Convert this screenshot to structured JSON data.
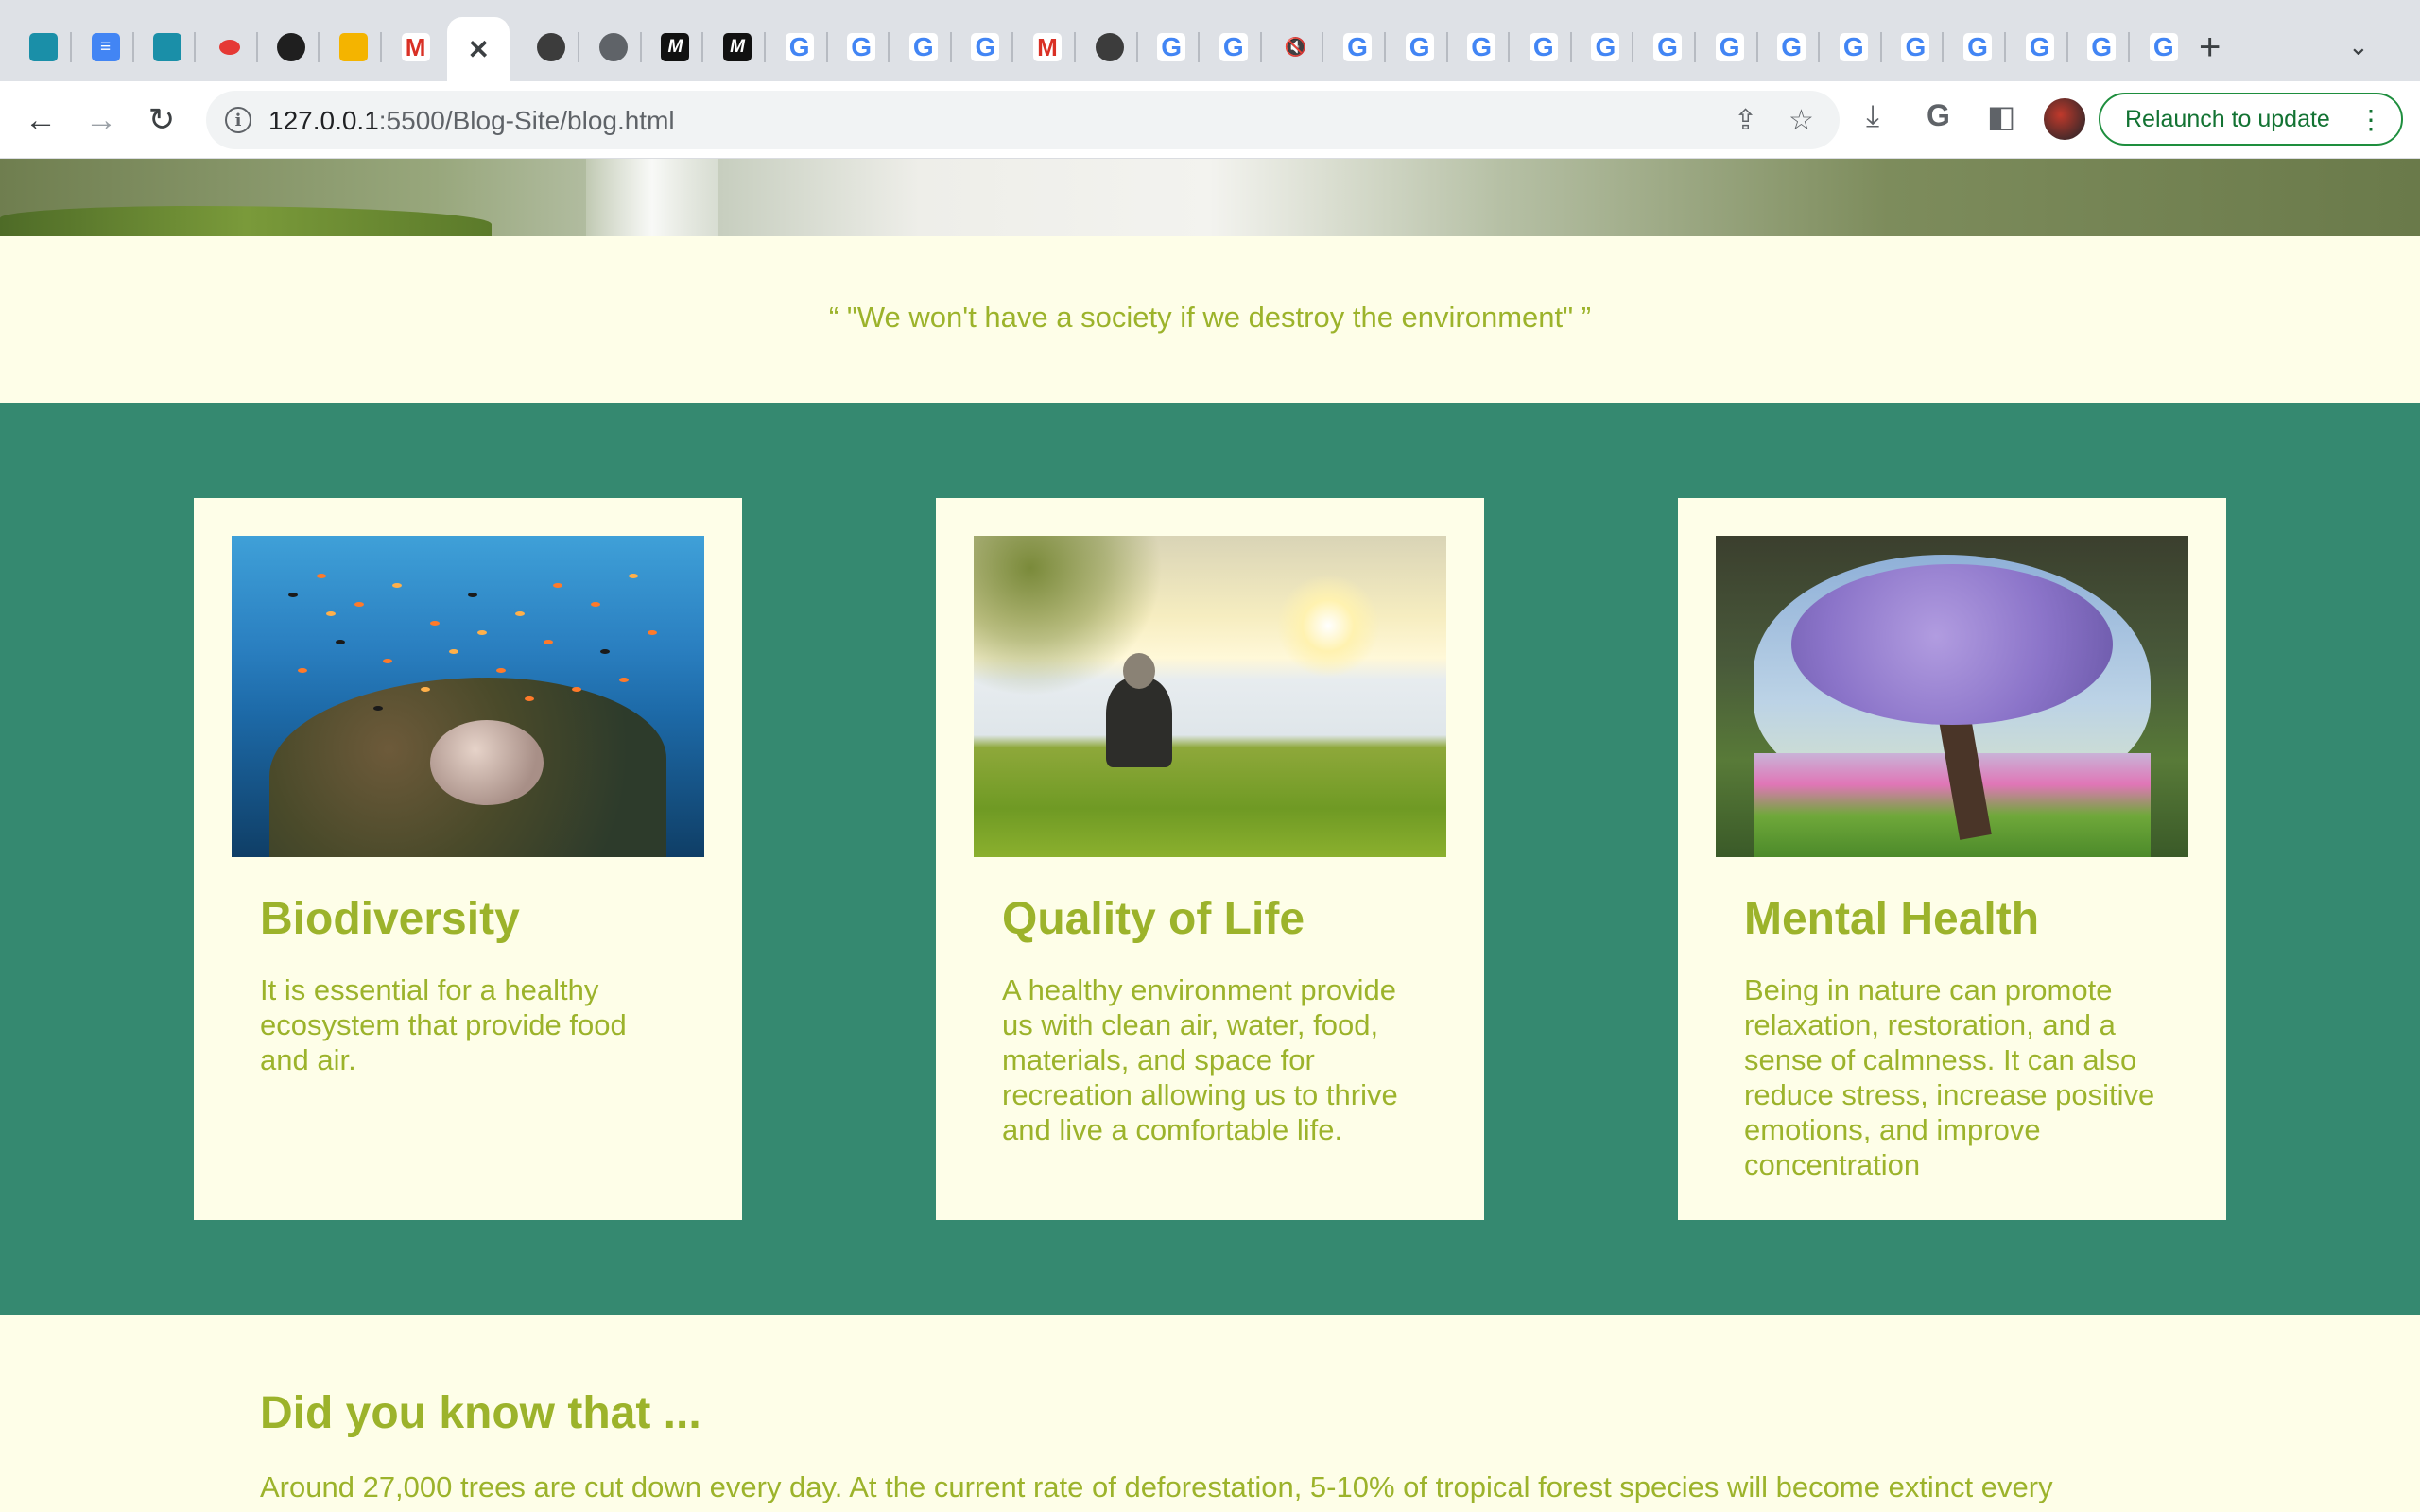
{
  "browser": {
    "tabs": [
      {
        "icon": "contacts-icon",
        "glyph": ""
      },
      {
        "icon": "google-docs-icon",
        "glyph": "≡"
      },
      {
        "icon": "contacts-icon",
        "glyph": ""
      },
      {
        "icon": "record-icon",
        "glyph": ""
      },
      {
        "icon": "github-icon",
        "glyph": ""
      },
      {
        "icon": "google-slides-icon",
        "glyph": ""
      },
      {
        "icon": "gmail-icon",
        "glyph": "M"
      },
      {
        "icon": "close-icon",
        "glyph": "✕",
        "active": true
      },
      {
        "icon": "chrome-icon",
        "glyph": ""
      },
      {
        "icon": "globe-icon",
        "glyph": ""
      },
      {
        "icon": "m-logo-icon",
        "glyph": "M"
      },
      {
        "icon": "m-logo-icon",
        "glyph": "M"
      },
      {
        "icon": "google-icon",
        "glyph": "G"
      },
      {
        "icon": "google-icon",
        "glyph": "G"
      },
      {
        "icon": "google-icon",
        "glyph": "G"
      },
      {
        "icon": "google-icon",
        "glyph": "G"
      },
      {
        "icon": "gmail-icon",
        "glyph": "M"
      },
      {
        "icon": "chrome-icon",
        "glyph": ""
      },
      {
        "icon": "google-icon",
        "glyph": "G"
      },
      {
        "icon": "google-icon",
        "glyph": "G"
      },
      {
        "icon": "muted-icon",
        "glyph": "🔇"
      },
      {
        "icon": "google-icon",
        "glyph": "G"
      },
      {
        "icon": "google-icon",
        "glyph": "G"
      },
      {
        "icon": "google-icon",
        "glyph": "G"
      },
      {
        "icon": "google-icon",
        "glyph": "G"
      },
      {
        "icon": "google-icon",
        "glyph": "G"
      },
      {
        "icon": "google-icon",
        "glyph": "G"
      },
      {
        "icon": "google-icon",
        "glyph": "G"
      },
      {
        "icon": "google-icon",
        "glyph": "G"
      },
      {
        "icon": "google-icon",
        "glyph": "G"
      },
      {
        "icon": "google-icon",
        "glyph": "G"
      },
      {
        "icon": "google-icon",
        "glyph": "G"
      },
      {
        "icon": "google-icon",
        "glyph": "G"
      },
      {
        "icon": "google-icon",
        "glyph": "G"
      },
      {
        "icon": "google-icon",
        "glyph": "G"
      }
    ],
    "address": {
      "host": "127.0.0.1",
      "path": ":5500/Blog-Site/blog.html"
    },
    "relaunch_label": "Relaunch to update"
  },
  "page": {
    "quote": "“ \"We won't have a society if we destroy the environment\" ”",
    "cards": [
      {
        "title": "Biodiversity",
        "body": "It is essential for a healthy ecosystem that provide food and air.",
        "image": "coral-reef-image"
      },
      {
        "title": "Quality of Life",
        "body": "A healthy environment provide us with clean air, water, food, materials, and space for recreation allowing us to thrive and live a comfortable life.",
        "image": "lakeside-person-image"
      },
      {
        "title": "Mental Health",
        "body": "Being in nature can promote relaxation, restoration, and a sense of calmness. It can also reduce stress, increase positive emotions, and improve concentration",
        "image": "tree-brain-image"
      }
    ],
    "did_you_know": {
      "title": "Did you know that ...",
      "text": "Around 27,000 trees are cut down every day. At the current rate of deforestation, 5-10% of tropical forest species will become extinct every"
    }
  },
  "colors": {
    "accent_text": "#9cb32b",
    "band": "#358970",
    "page_bg": "#fefee8",
    "relaunch": "#1e8e3e"
  }
}
